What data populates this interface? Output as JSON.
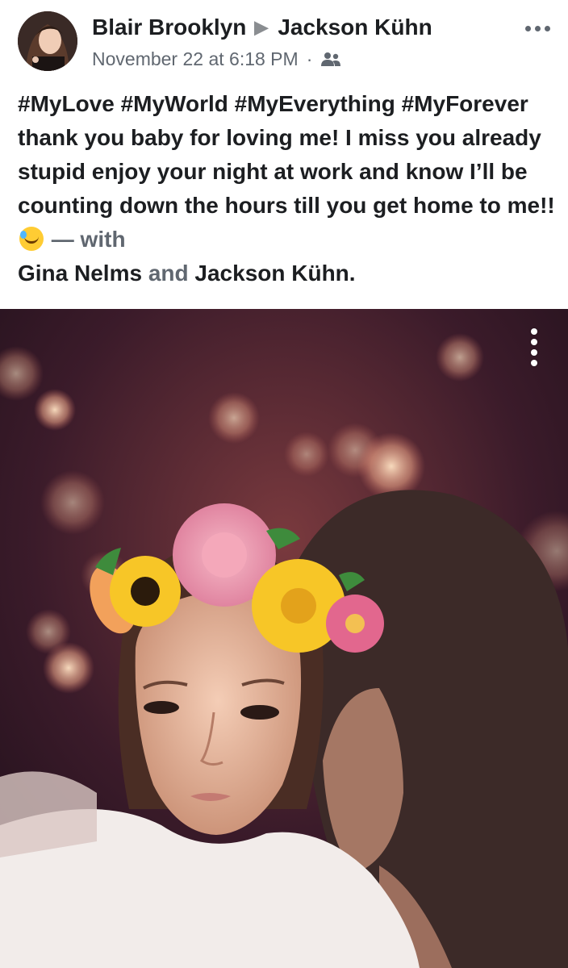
{
  "post": {
    "author": "Blair Brooklyn",
    "recipient": "Jackson Kühn",
    "timestamp": "November 22 at 6:18 PM",
    "audience_icon": "friends-icon",
    "text_main": "#MyLove #MyWorld #MyEverything #MyForever thank you baby for loving me! I miss you already stupid enjoy your night at work and know I’ll be counting down the hours till you get home to me!!",
    "with_label": "— with",
    "tagged_1": "Gina Nelms",
    "and_label": "and",
    "tagged_2": "Jackson Kühn",
    "period": "."
  },
  "icons": {
    "more": "more-horizontal-icon",
    "photo_more": "more-vertical-icon",
    "emoji": "rolling-laughing-emoji"
  },
  "colors": {
    "text": "#1c1e21",
    "meta": "#606770"
  }
}
